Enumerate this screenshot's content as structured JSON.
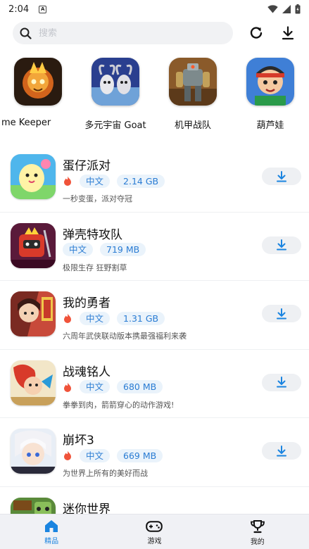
{
  "status_bar": {
    "time": "2:04",
    "notification_icon": "a-notification-icon"
  },
  "search": {
    "placeholder": "搜索",
    "value": ""
  },
  "featured": [
    {
      "label": "me Keeper",
      "icon": "flame-spirit-game-icon"
    },
    {
      "label": "多元宇宙 Goat",
      "icon": "goat-game-icon"
    },
    {
      "label": "机甲战队",
      "icon": "mech-game-icon"
    },
    {
      "label": "葫芦娃",
      "icon": "calabash-brothers-game-icon"
    }
  ],
  "apps": [
    {
      "name": "蛋仔派对",
      "hot": true,
      "lang": "中文",
      "size": "2.14 GB",
      "desc": "一秒变蛋，派对夺冠"
    },
    {
      "name": "弹壳特攻队",
      "hot": false,
      "lang": "中文",
      "size": "719 MB",
      "desc": "极限生存 狂野割草"
    },
    {
      "name": "我的勇者",
      "hot": true,
      "lang": "中文",
      "size": "1.31 GB",
      "desc": "六周年武侠联动版本携最强福利来袭"
    },
    {
      "name": "战魂铭人",
      "hot": true,
      "lang": "中文",
      "size": "680 MB",
      "desc": "拳拳到肉，箭箭穿心的动作游戏!"
    },
    {
      "name": "崩坏3",
      "hot": true,
      "lang": "中文",
      "size": "669 MB",
      "desc": "为世界上所有的美好而战"
    },
    {
      "name": "迷你世界",
      "hot": false,
      "lang": "",
      "size": "",
      "desc": ""
    }
  ],
  "nav": [
    {
      "label": "精品",
      "icon": "home-icon",
      "active": true
    },
    {
      "label": "游戏",
      "icon": "gamepad-icon",
      "active": false
    },
    {
      "label": "我的",
      "icon": "trophy-icon",
      "active": false
    }
  ],
  "colors": {
    "accent": "#1a84e0",
    "tag_bg": "#eaf3fb",
    "tag_text": "#2a7cd3",
    "hot": "#f0533a"
  }
}
